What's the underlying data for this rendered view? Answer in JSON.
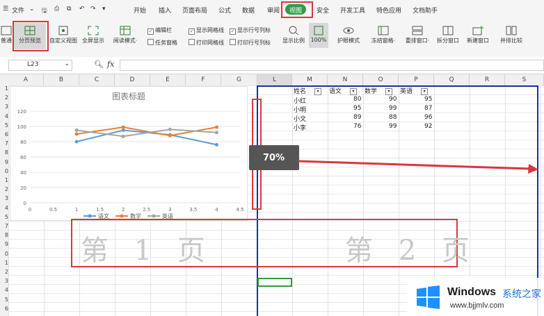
{
  "menu": {
    "file": "文件",
    "tabs": [
      "开始",
      "插入",
      "页面布局",
      "公式",
      "数据",
      "审阅",
      "视图",
      "安全",
      "开发工具",
      "特色应用",
      "文档助手"
    ],
    "active": "视图"
  },
  "toolbar": {
    "normal": "普通",
    "page_break": "分页预览",
    "custom_view": "自定义视图",
    "fullscreen": "全屏显示",
    "reading_mode": "阅读模式·",
    "edit_bar": "编辑栏",
    "task_pane": "任务窗格",
    "show_grid": "显示网格线",
    "print_grid": "打印网格线",
    "show_headers": "显示行号列标",
    "print_headers": "打印行号列标",
    "zoom": "显示比例",
    "zoom100": "100%",
    "eye_mode": "护眼模式",
    "freeze": "冻结窗格·",
    "rearrange": "重排窗口·",
    "split": "拆分窗口",
    "new_window": "新建窗口",
    "side_by_side": "并排比较"
  },
  "formula": {
    "cell_ref": "L23",
    "fx": "fx"
  },
  "columns": [
    "A",
    "B",
    "C",
    "D",
    "E",
    "F",
    "G",
    "L",
    "M",
    "N",
    "O",
    "P",
    "Q",
    "R",
    "S"
  ],
  "rows": [
    "1",
    "2",
    "3",
    "4",
    "5",
    "6",
    "7",
    "8",
    "9",
    "0",
    "1",
    "2",
    "3",
    "4",
    "5",
    "7",
    "8",
    "9",
    "0",
    "1",
    "2",
    "3",
    "4",
    "5",
    "6"
  ],
  "table": {
    "headers": [
      "姓名",
      "语文",
      "数学",
      "英语"
    ],
    "rows": [
      [
        "小红",
        "80",
        "90",
        "95"
      ],
      [
        "小明",
        "95",
        "99",
        "87"
      ],
      [
        "小文",
        "89",
        "88",
        "96"
      ],
      [
        "小李",
        "76",
        "99",
        "92"
      ]
    ]
  },
  "tooltip": "70%",
  "pages": [
    "第 1 页",
    "第 2 页"
  ],
  "watermark": {
    "brand": "Windows",
    "cn": "系统之家",
    "url": "www.bjjmlv.com"
  },
  "chart_data": {
    "type": "line",
    "title": "图表标题",
    "x": [
      1,
      2,
      3,
      4
    ],
    "xlim": [
      0,
      4.5
    ],
    "xticks": [
      "0",
      "0.5",
      "1",
      "1.5",
      "2",
      "2.5",
      "3",
      "3.5",
      "4",
      "4.5"
    ],
    "ylim": [
      0,
      120
    ],
    "yticks": [
      "0",
      "20",
      "40",
      "60",
      "80",
      "100",
      "120"
    ],
    "grid": true,
    "legend": "bottom",
    "series": [
      {
        "name": "语文",
        "values": [
          80,
          95,
          89,
          76
        ],
        "color": "#5b9bd5"
      },
      {
        "name": "数学",
        "values": [
          90,
          99,
          88,
          99
        ],
        "color": "#ed7d31"
      },
      {
        "name": "英语",
        "values": [
          95,
          87,
          96,
          92
        ],
        "color": "#a5a5a5"
      }
    ]
  }
}
